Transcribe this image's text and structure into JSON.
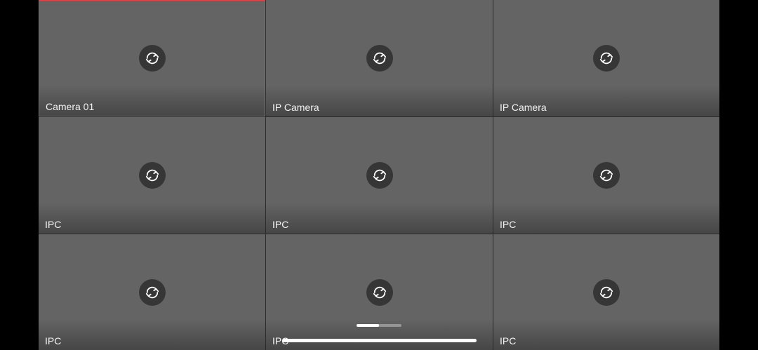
{
  "cameras": [
    {
      "name": "Camera 01",
      "selected": true,
      "icon": "refresh-icon"
    },
    {
      "name": "IP Camera",
      "selected": false,
      "icon": "refresh-icon"
    },
    {
      "name": "IP Camera",
      "selected": false,
      "icon": "refresh-icon"
    },
    {
      "name": "IPC",
      "selected": false,
      "icon": "refresh-icon"
    },
    {
      "name": "IPC",
      "selected": false,
      "icon": "refresh-icon"
    },
    {
      "name": "IPC",
      "selected": false,
      "icon": "refresh-icon"
    },
    {
      "name": "IPC",
      "selected": false,
      "icon": "refresh-icon"
    },
    {
      "name": "IPC",
      "selected": false,
      "icon": "refresh-icon"
    },
    {
      "name": "IPC",
      "selected": false,
      "icon": "refresh-icon"
    }
  ],
  "pager": {
    "current_page": 1,
    "total_pages": 2
  },
  "colors": {
    "selected_border": "#e0454a",
    "tile_background": "#646464",
    "icon_background": "#363636"
  }
}
